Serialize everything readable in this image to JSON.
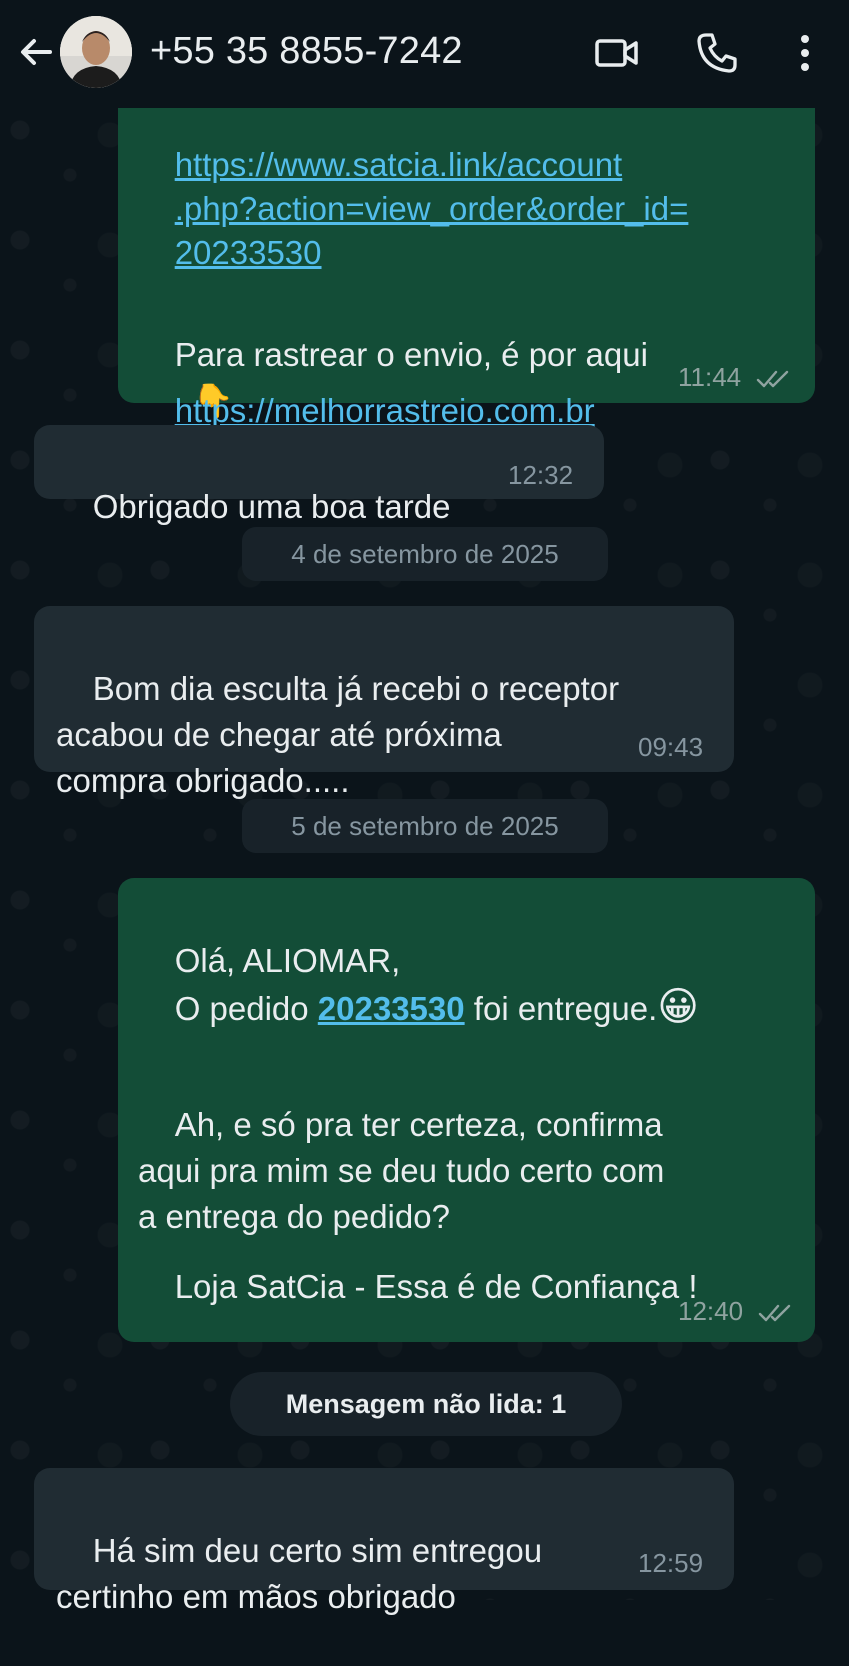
{
  "header": {
    "title": "+55 35 8855-7242",
    "back_icon": "arrow-left-icon",
    "video_icon": "video-call-icon",
    "call_icon": "phone-icon",
    "more_icon": "more-vert-icon"
  },
  "messages": [
    {
      "type": "outgoing",
      "link_top_partial": "https://www.satcia.link/account",
      "link_line2": ".php?action=view_order&order_id=",
      "link_line3": "20233530",
      "text_track": "Para rastrear o envio, é por aqui",
      "emoji": "👇",
      "link_track": "https://melhorrastreio.com.br",
      "time": "11:44"
    },
    {
      "type": "incoming",
      "text": "Obrigado uma boa tarde",
      "time": "12:32"
    },
    {
      "type": "incoming",
      "text": "Bom dia esculta já recebi o receptor\nacabou de chegar até próxima\ncompra obrigado.....",
      "time": "09:43"
    },
    {
      "type": "outgoing",
      "greeting": "Olá, ALIOMAR,",
      "order_prefix": "O pedido ",
      "order_number": "20233530",
      "order_suffix": " foi entregue.",
      "emoji": "😀",
      "question": "Ah, e só pra ter certeza, confirma\naqui pra mim se deu tudo certo com\na entrega do pedido?",
      "signature": "Loja SatCia - Essa é de Confiança !",
      "time": "12:40"
    },
    {
      "type": "incoming",
      "text": "Há sim deu certo sim entregou\ncertinho em mãos obrigado",
      "time": "12:59"
    }
  ],
  "dates": {
    "first": "4 de setembro de 2025",
    "second": "5 de setembro de 2025"
  },
  "unread_label": "Mensagem não lida: 1",
  "colors": {
    "background": "#0b141a",
    "outgoing_bubble": "#134d37",
    "incoming_bubble": "#202c33",
    "link": "#53bdeb",
    "text": "#e9edef"
  }
}
